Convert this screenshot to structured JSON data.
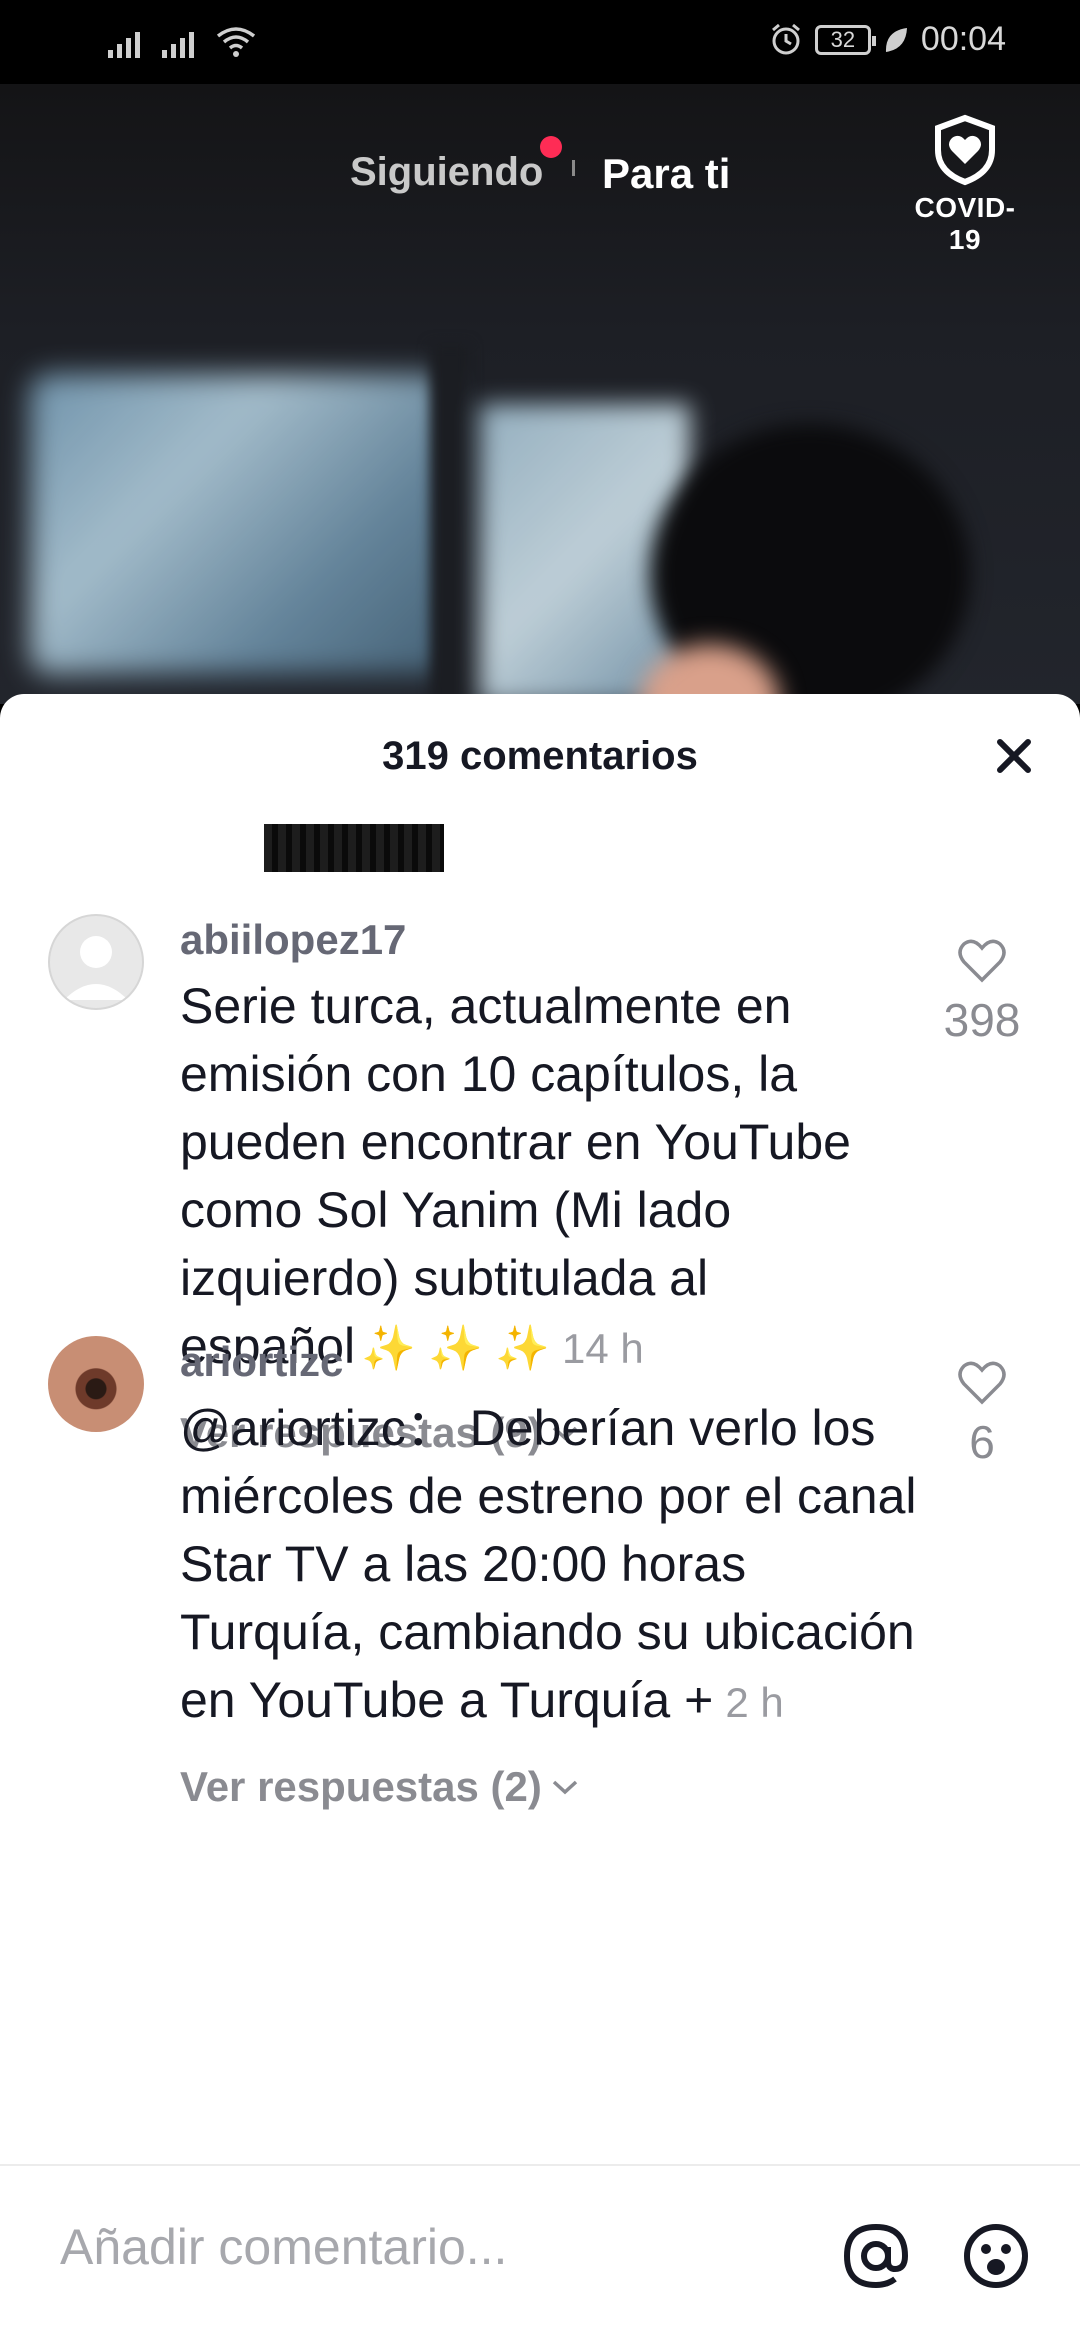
{
  "status_bar": {
    "battery": "32",
    "time": "00:04"
  },
  "header_tabs": {
    "following": "Siguiendo",
    "for_you": "Para ti",
    "covid_label": "COVID-19"
  },
  "comments_panel": {
    "title": "319 comentarios",
    "comments": [
      {
        "username": "abiilopez17",
        "text": "Serie turca, actualmente en emisión con 10 capítulos, la pueden encontrar en YouTube como Sol Yanim (Mi lado izquierdo) subtitulada al español",
        "emoji": "✨ ✨ ✨",
        "time": "14 h",
        "likes": "398",
        "replies": "Ver respuestas (9)"
      },
      {
        "username": "ariortizc",
        "mention": "@ariortizc：",
        "text": " Deberían verlo los miércoles de estreno por el canal Star TV a las 20:00 horas Turquía, cambiando su ubicación en YouTube a Turquía +",
        "time": "2 h",
        "likes": "6",
        "replies": "Ver respuestas (2)"
      }
    ]
  },
  "input": {
    "placeholder": "Añadir comentario..."
  },
  "colors": {
    "accent_red": "#fe2c55",
    "text_primary": "#161823",
    "text_secondary": "#8a8b91"
  }
}
